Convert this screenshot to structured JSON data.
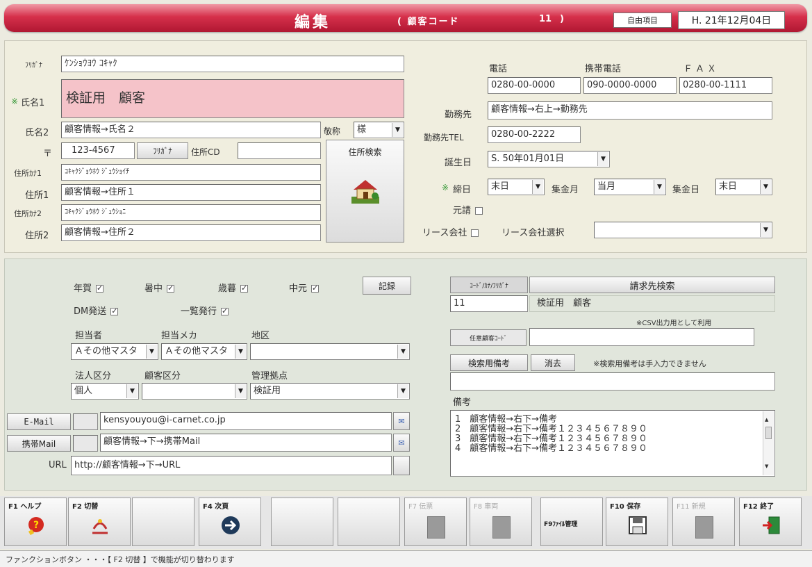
{
  "header": {
    "title": "編集",
    "code_label": "( 顧客コード",
    "code_value": "11",
    "code_close": ")",
    "jiyu_button": "自由項目",
    "date": "H. 21年12月04日"
  },
  "customer": {
    "furigana_label": "ﾌﾘｶﾞﾅ",
    "furigana_value": "ｹﾝｼｮｳﾖｳ ｺｷｬｸ",
    "name1_marker": "※",
    "name1_label": "氏名1",
    "name1_value": "検証用　顧客",
    "name2_label": "氏名2",
    "name2_value": "顧客情報→氏名２",
    "keisho_label": "敬称",
    "keisho_value": "様",
    "postal_label": "〒",
    "postal_value": "123-4567",
    "furigana_button": "ﾌﾘｶﾞﾅ",
    "address_cd_label": "住所CD",
    "address_cd_value": "",
    "address_search_button": "住所検索",
    "address_kana1_label": "住所ｶﾅ1",
    "address_kana1_value": "ｺｷｬｸｼﾞｮｳﾎｳ ｼﾞｭｳｼｮｲﾁ",
    "address1_label": "住所1",
    "address1_value": "顧客情報→住所１",
    "address_kana2_label": "住所ｶﾅ2",
    "address_kana2_value": "ｺｷｬｸｼﾞｮｳﾎｳ ｼﾞｭｳｼｮﾆ",
    "address2_label": "住所2",
    "address2_value": "顧客情報→住所２"
  },
  "contact": {
    "phone_label": "電話",
    "mobile_label": "携帯電話",
    "fax_label": "ＦＡＸ",
    "phone_value": "0280-00-0000",
    "mobile_value": "090-0000-0000",
    "fax_value": "0280-00-1111",
    "workplace_label": "勤務先",
    "workplace_value": "顧客情報→右上→勤務先",
    "workplace_tel_label": "勤務先TEL",
    "workplace_tel_value": "0280-00-2222",
    "birthday_label": "誕生日",
    "birthday_value": "S. 50年01月01日",
    "closing_marker": "※",
    "closing_label": "締日",
    "closing_value": "末日",
    "collect_month_label": "集金月",
    "collect_month_value": "当月",
    "collect_day_label": "集金日",
    "collect_day_value": "末日",
    "motouke_label": "元請",
    "lease_label": "リース会社",
    "lease_select_label": "リース会社選択",
    "lease_select_value": ""
  },
  "flags": {
    "nenga_label": "年賀",
    "shochu_label": "暑中",
    "seibo_label": "歳暮",
    "chugen_label": "中元",
    "kiroku_button": "記録",
    "dm_label": "DM発送",
    "ichiran_label": "一覧発行"
  },
  "assign": {
    "tantou_label": "担当者",
    "tantou_value": "Ａその他マスタ",
    "maker_label": "担当メカ",
    "maker_value": "Ａその他マスタ",
    "area_label": "地区",
    "area_value": "",
    "houjin_label": "法人区分",
    "houjin_value": "個人",
    "kokyaku_label": "顧客区分",
    "kokyaku_value": "",
    "kyoten_label": "管理拠点",
    "kyoten_value": "検証用"
  },
  "mail": {
    "email_button": "E-Mail",
    "email_value": "kensyouyou@i-carnet.co.jp",
    "mobile_mail_button": "携帯Mail",
    "mobile_mail_value": "顧客情報→下→携帯Mail",
    "url_label": "URL",
    "url_value": "http://顧客情報→下→URL",
    "mail_icon": "mail-icon"
  },
  "billing": {
    "code_kana_label": "ｺｰﾄﾞ/ｶﾅ/ﾌﾘｶﾞﾅ",
    "search_button": "請求先検索",
    "code_value": "11",
    "name_value": "検証用　顧客",
    "csv_note": "※CSV出力用として利用",
    "nini_label": "任意顧客ｺｰﾄﾞ",
    "nini_value": "",
    "kensaku_biko_button": "検索用備考",
    "clear_button": "消去",
    "kensaku_note": "※検索用備考は手入力できません",
    "kensaku_value": "",
    "biko_label": "備考",
    "biko_lines": [
      "1　顧客情報→右下→備考",
      "2　顧客情報→右下→備考１２３４５６７８９０",
      "3　顧客情報→右下→備考１２３４５６７８９０",
      "4　顧客情報→右下→備考１２３４５６７８９０"
    ]
  },
  "function_keys": [
    {
      "label": "F1 ヘルプ",
      "icon": "help-icon",
      "enabled": true
    },
    {
      "label": "F2 切替",
      "icon": "switch-icon",
      "enabled": true
    },
    {
      "label": "",
      "icon": "",
      "enabled": true
    },
    {
      "label": "F4 次頁",
      "icon": "next-page-icon",
      "enabled": true
    },
    {
      "label": "",
      "icon": "",
      "enabled": true
    },
    {
      "label": "",
      "icon": "",
      "enabled": true
    },
    {
      "label": "F7 伝票",
      "icon": "",
      "enabled": false
    },
    {
      "label": "F8 車両",
      "icon": "",
      "enabled": false
    },
    {
      "label": "F9ﾌｧｲﾙ管理",
      "icon": "",
      "enabled": true
    },
    {
      "label": "F10 保存",
      "icon": "save-icon",
      "enabled": true
    },
    {
      "label": "F11 新規",
      "icon": "",
      "enabled": false
    },
    {
      "label": "F12 終了",
      "icon": "exit-icon",
      "enabled": true
    }
  ],
  "status": "ファンクションボタン ・・・【 F2 切替 】で機能が切り替わります"
}
